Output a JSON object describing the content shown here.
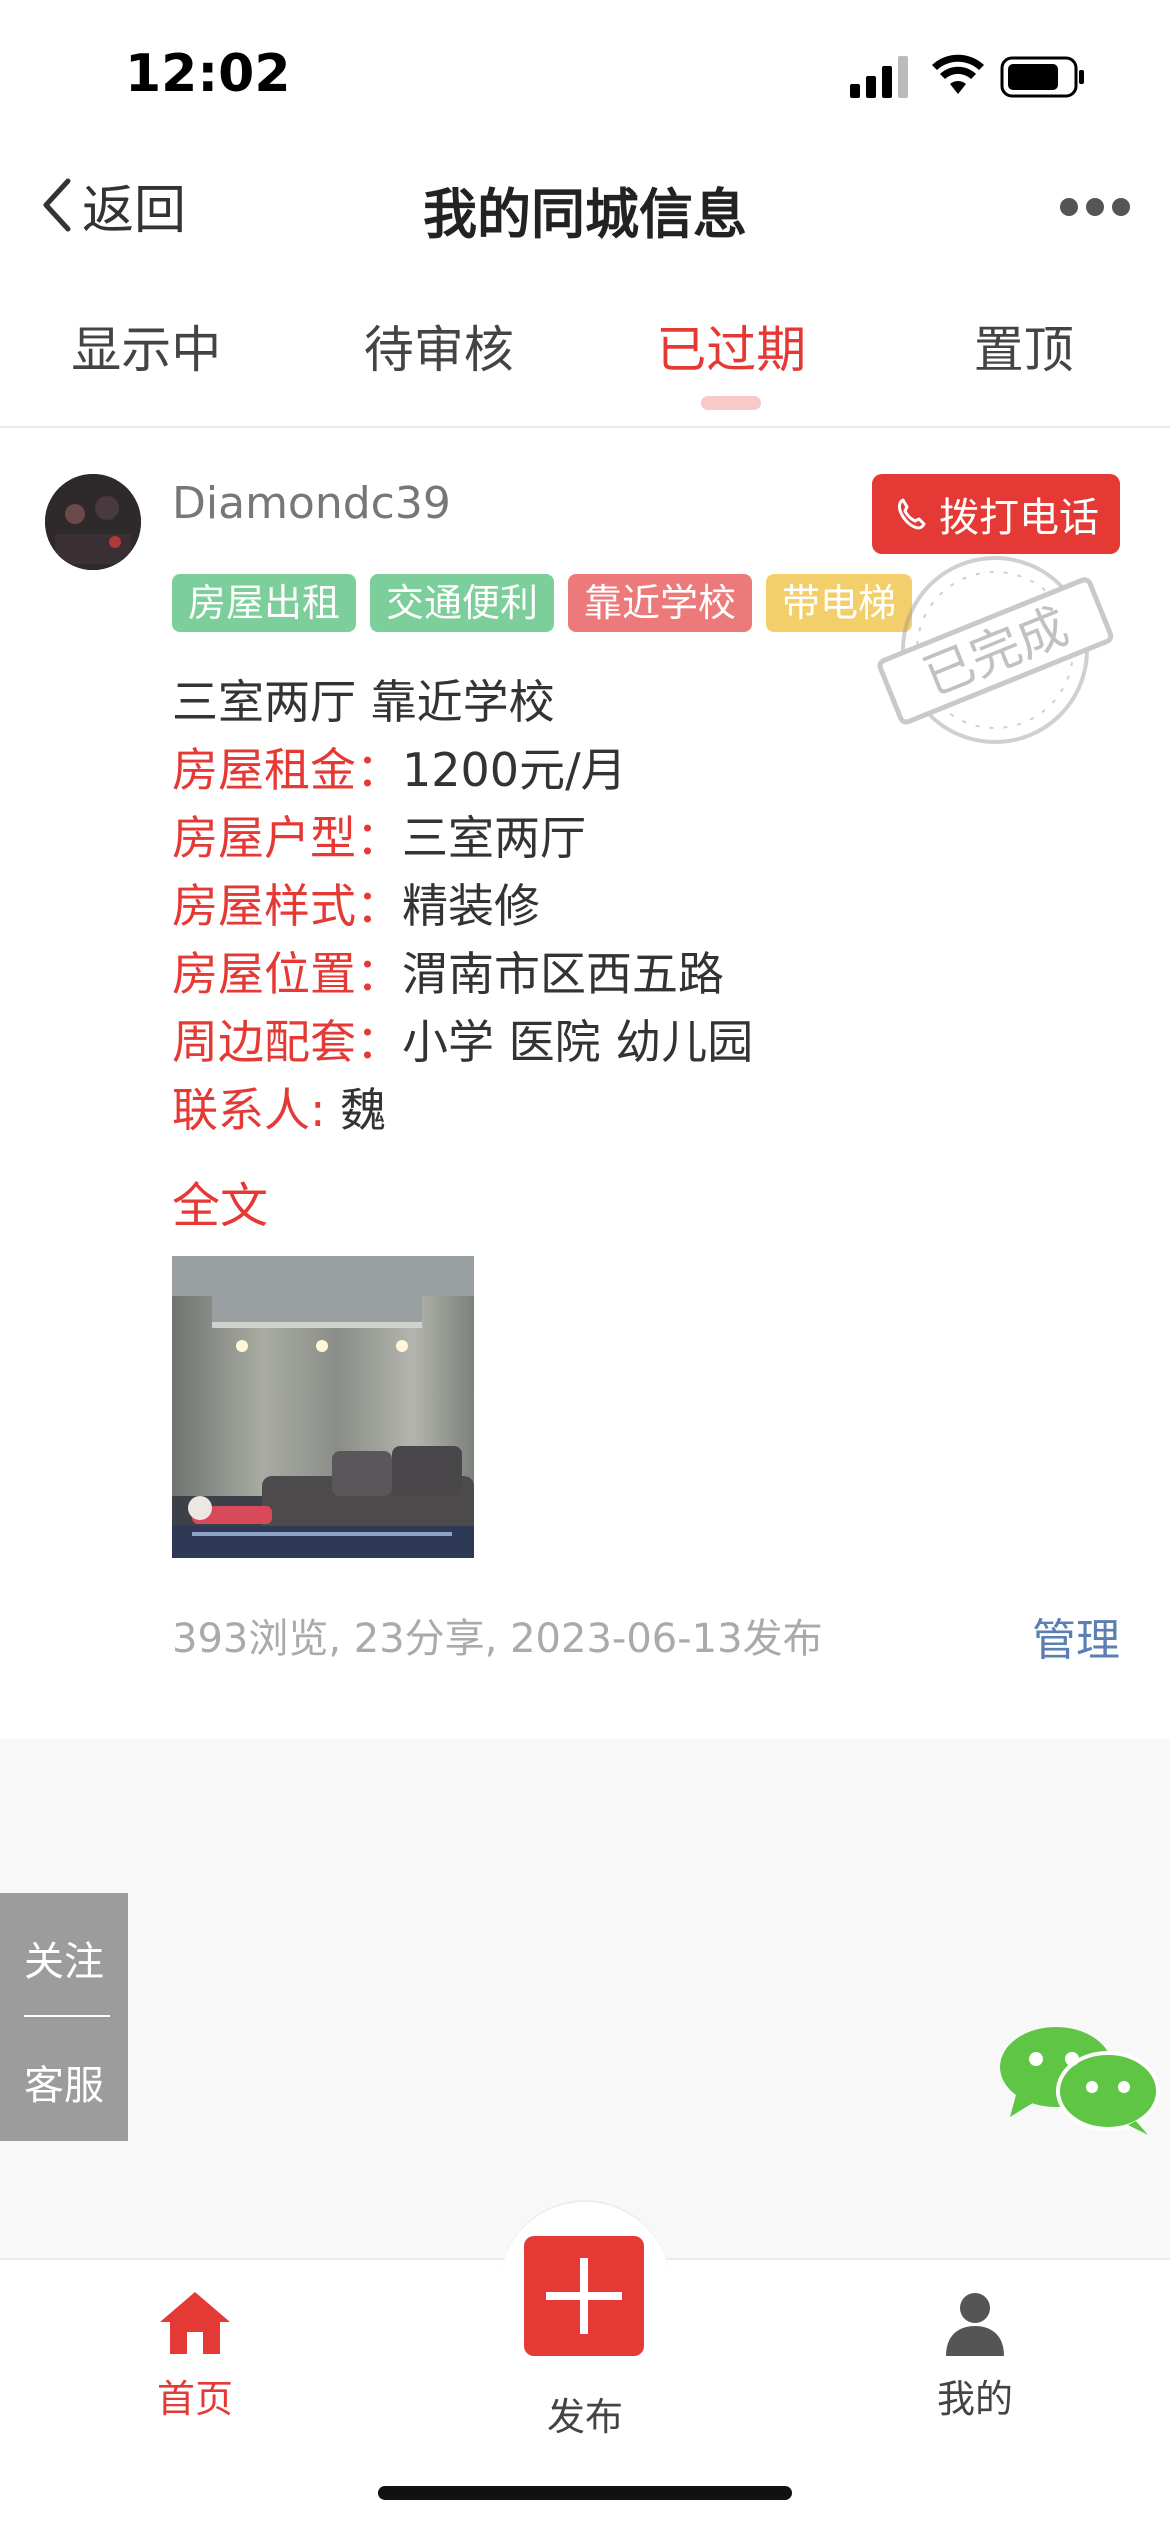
{
  "status_bar": {
    "time": "12:02"
  },
  "nav": {
    "back_label": "返回",
    "title": "我的同城信息"
  },
  "tabs": [
    {
      "label": "显示中",
      "active": false
    },
    {
      "label": "待审核",
      "active": false
    },
    {
      "label": "已过期",
      "active": true
    },
    {
      "label": "置顶",
      "active": false
    }
  ],
  "post": {
    "username": "Diamondc39",
    "call_label": "拨打电话",
    "stamp_text": "已完成",
    "tags": [
      {
        "label": "房屋出租",
        "color": "#7ccf9b"
      },
      {
        "label": "交通便利",
        "color": "#7ccf9b"
      },
      {
        "label": "靠近学校",
        "color": "#ec7a7a"
      },
      {
        "label": "带电梯",
        "color": "#f3cf6b"
      }
    ],
    "headline": "三室两厅 靠近学校",
    "fields": [
      {
        "key": "房屋租金：",
        "value": "1200元/月"
      },
      {
        "key": "房屋户型：",
        "value": "三室两厅"
      },
      {
        "key": "房屋样式：",
        "value": "精装修"
      },
      {
        "key": "房屋位置：",
        "value": "渭南市区西五路"
      },
      {
        "key": "周边配套：",
        "value": "小学 医院 幼儿园"
      },
      {
        "key": "联系人: ",
        "value": "魏"
      }
    ],
    "fulltext_label": "全文",
    "meta": "393浏览, 23分享, 2023-06-13发布",
    "manage_label": "管理"
  },
  "side_box": {
    "follow": "关注",
    "service": "客服"
  },
  "bottom_nav": {
    "home": "首页",
    "publish": "发布",
    "mine": "我的"
  },
  "colors": {
    "accent": "#e53935",
    "link": "#5b7fb3"
  }
}
